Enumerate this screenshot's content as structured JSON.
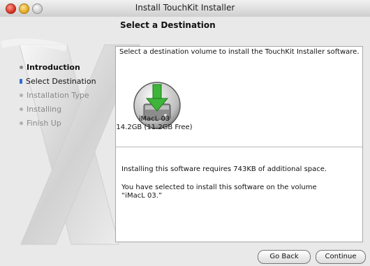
{
  "window": {
    "title": "Install TouchKit Installer"
  },
  "heading": "Select a Destination",
  "steps": [
    {
      "label": "Introduction",
      "state": "done"
    },
    {
      "label": "Select Destination",
      "state": "active"
    },
    {
      "label": "Installation Type",
      "state": "pending"
    },
    {
      "label": "Installing",
      "state": "pending"
    },
    {
      "label": "Finish Up",
      "state": "pending"
    }
  ],
  "content": {
    "intro": "Select a destination volume to install the TouchKit Installer software.",
    "volume": {
      "name": "iMacL 03",
      "size": "14.2GB (11.2GB Free)",
      "icon": "hard-drive-install-icon"
    },
    "requirement": "Installing this software requires 743KB of additional space.",
    "selected": "You have selected to install this software on the volume “iMacL 03.”"
  },
  "buttons": {
    "back": "Go Back",
    "continue": "Continue"
  },
  "colors": {
    "accent": "#2b6fd6",
    "arrow": "#3fb43a"
  }
}
